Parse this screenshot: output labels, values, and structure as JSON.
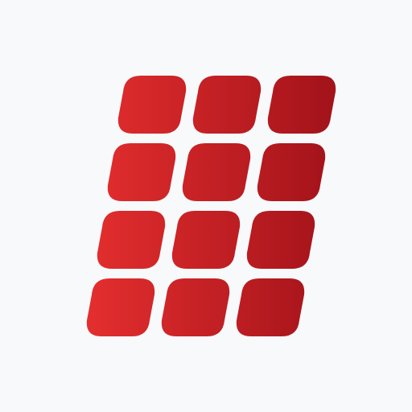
{
  "app_icon": {
    "icon": "keypad-grid-logo-icon",
    "background_color": "#f7f9fb",
    "tile_color_light": "#e62f2f",
    "tile_color_dark": "#a3131a",
    "rows": 4,
    "columns": 3
  }
}
